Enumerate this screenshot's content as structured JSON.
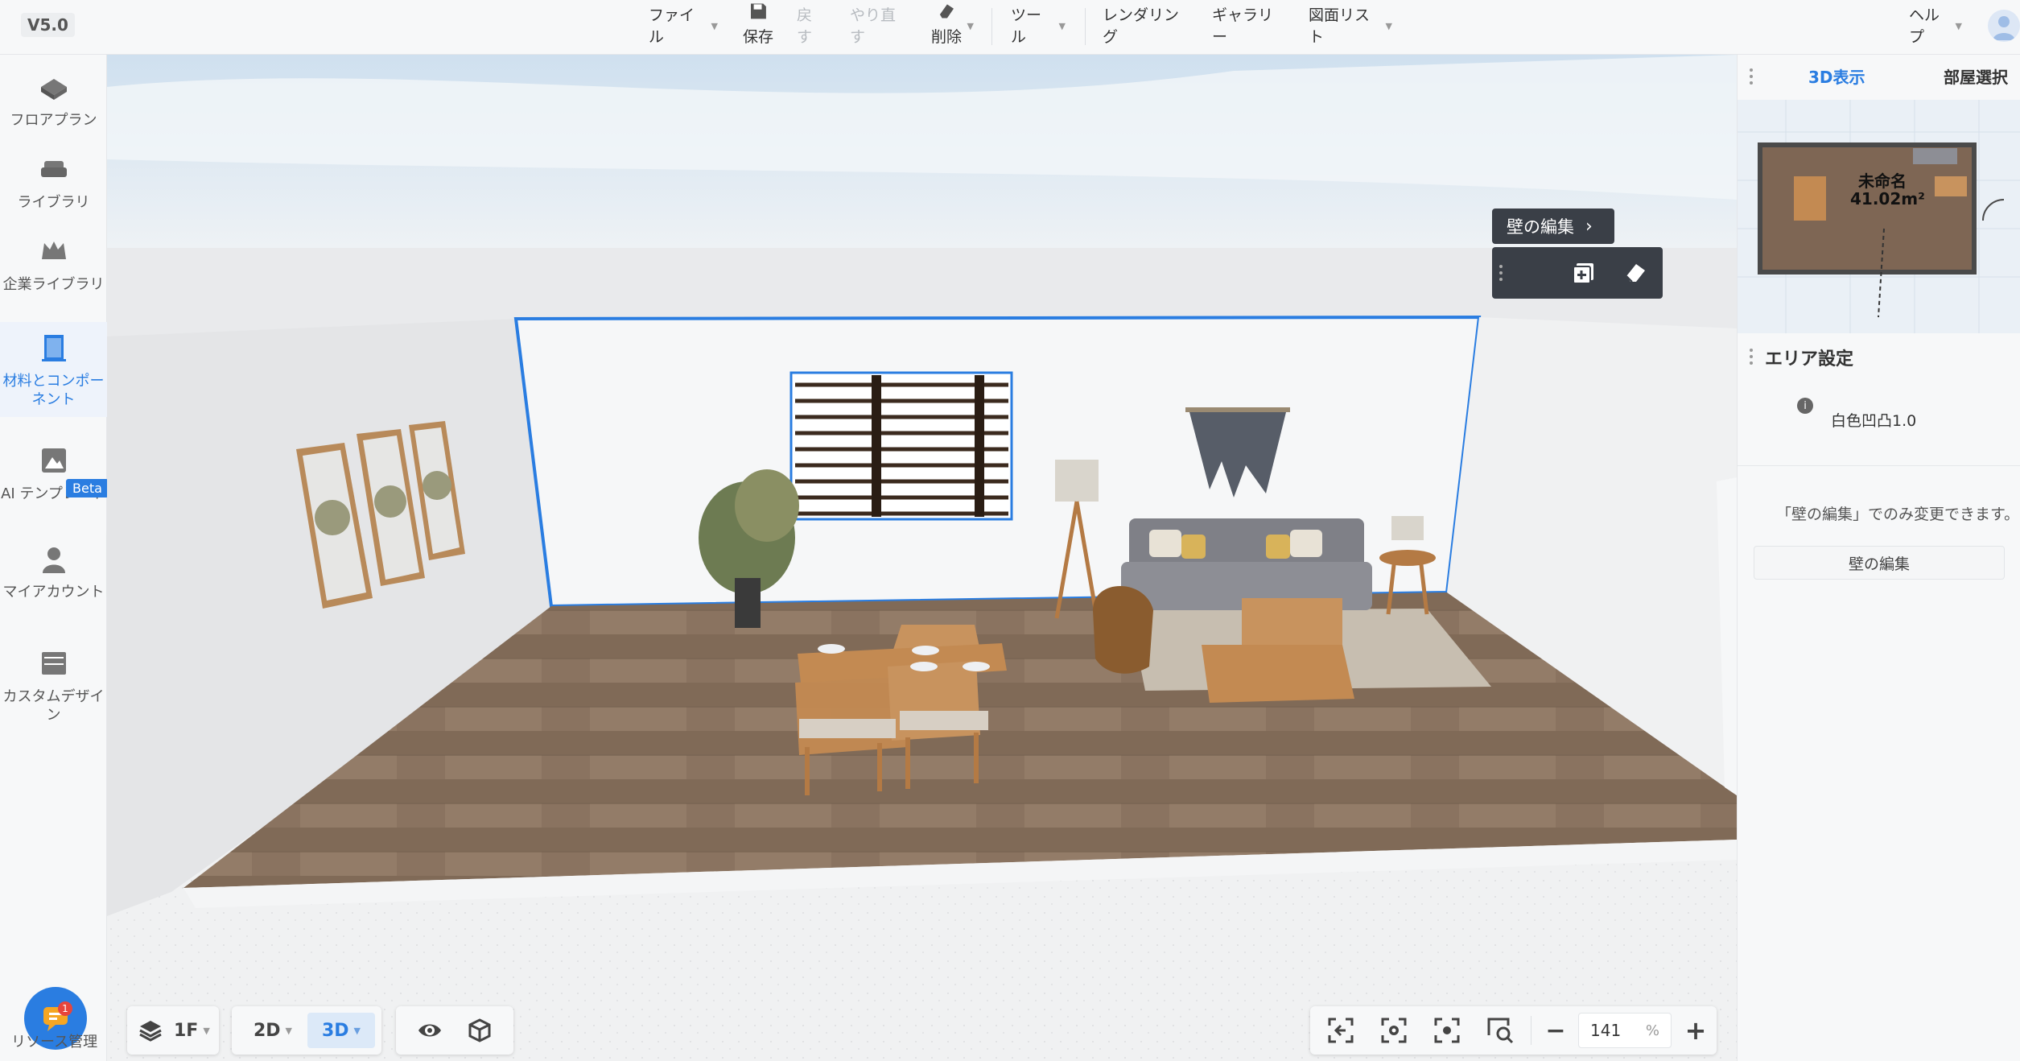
{
  "app": {
    "version": "V5.0"
  },
  "toolbar": {
    "file": "ファイル",
    "save": "保存",
    "undo": "戻す",
    "redo": "やり直す",
    "delete": "削除",
    "tools": "ツール",
    "rendering": "レンダリング",
    "gallery": "ギャラリー",
    "drawing_list": "図面リスト",
    "help": "ヘルプ"
  },
  "sidebar": {
    "items": [
      {
        "label": "フロアプラン",
        "icon": "floorplan-icon"
      },
      {
        "label": "ライブラリ",
        "icon": "sofa-icon"
      },
      {
        "label": "企業ライブラリ",
        "icon": "crown-icon"
      },
      {
        "label": "材料とコンポーネント",
        "icon": "door-icon",
        "active": true
      },
      {
        "label": "AI テンプレート",
        "icon": "ai-template-icon",
        "badge": "Beta"
      },
      {
        "label": "マイアカウント",
        "icon": "user-icon"
      },
      {
        "label": "カスタムデザイン",
        "icon": "cabinet-icon"
      }
    ],
    "chat_label": "リソース管理",
    "chat_badge": "1"
  },
  "floating": {
    "wall_edit": "壁の編集"
  },
  "right_panel": {
    "tabs": [
      {
        "label": "3D表示",
        "active": true
      },
      {
        "label": "部屋選択",
        "active": false
      }
    ],
    "minimap": {
      "room_name": "未命名",
      "room_area": "41.02m²"
    },
    "area_settings": {
      "title": "エリア設定",
      "material_name": "白色凹凸1.0",
      "hint": "「壁の編集」でのみ変更できます。",
      "edit_button": "壁の編集"
    }
  },
  "bottom": {
    "floor": "1F",
    "mode_2d": "2D",
    "mode_3d": "3D",
    "zoom_value": "141",
    "zoom_unit": "%"
  },
  "colors": {
    "accent": "#2a7de1",
    "dark_panel": "#3a3f47",
    "floor_wood": "#8a7360"
  }
}
